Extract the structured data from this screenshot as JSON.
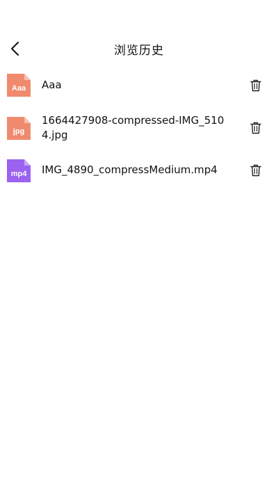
{
  "header": {
    "title": "浏览历史",
    "back_icon": "chevron-left-icon"
  },
  "files": [
    {
      "name": "Aaa",
      "type_label": "Aaa",
      "color": "#EF8A6F",
      "fold_color": "#F6BFAE",
      "delete_icon": "trash-icon"
    },
    {
      "name": "1664427908-compressed-IMG_5104.jpg",
      "type_label": "jpg",
      "color": "#EF8A6F",
      "fold_color": "#F6BFAE",
      "delete_icon": "trash-icon"
    },
    {
      "name": "IMG_4890_compressMedium.mp4",
      "type_label": "mp4",
      "color": "#9B63EF",
      "fold_color": "#C7A6F6",
      "delete_icon": "trash-icon"
    }
  ]
}
